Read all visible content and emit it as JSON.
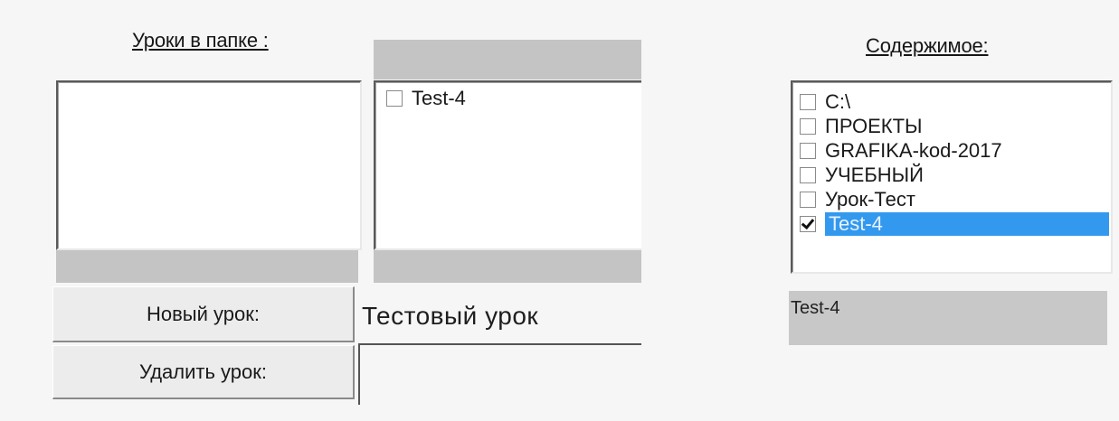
{
  "lessons_panel": {
    "heading": "Уроки в папке :",
    "folder_items": [],
    "lesson_items": [
      {
        "label": "Test-4",
        "checked": false
      }
    ]
  },
  "contents_panel": {
    "heading": "Содержимое:",
    "items": [
      {
        "label": "C:\\",
        "checked": false,
        "selected": false
      },
      {
        "label": "ПРОЕКТЫ",
        "checked": false,
        "selected": false
      },
      {
        "label": "GRAFIKA-kod-2017",
        "checked": false,
        "selected": false
      },
      {
        "label": "УЧЕБНЫЙ",
        "checked": false,
        "selected": false
      },
      {
        "label": "Урок-Тест",
        "checked": false,
        "selected": false
      },
      {
        "label": "Test-4",
        "checked": true,
        "selected": true
      }
    ],
    "current_path": "Test-4"
  },
  "actions": {
    "new_lesson_label": "Новый урок:",
    "delete_lesson_label": "Удалить урок:",
    "lesson_name_value": "Тестовый урок"
  },
  "colors": {
    "selection": "#3399ee",
    "background": "#f6f6f6",
    "panel_gray": "#c4c4c4"
  }
}
